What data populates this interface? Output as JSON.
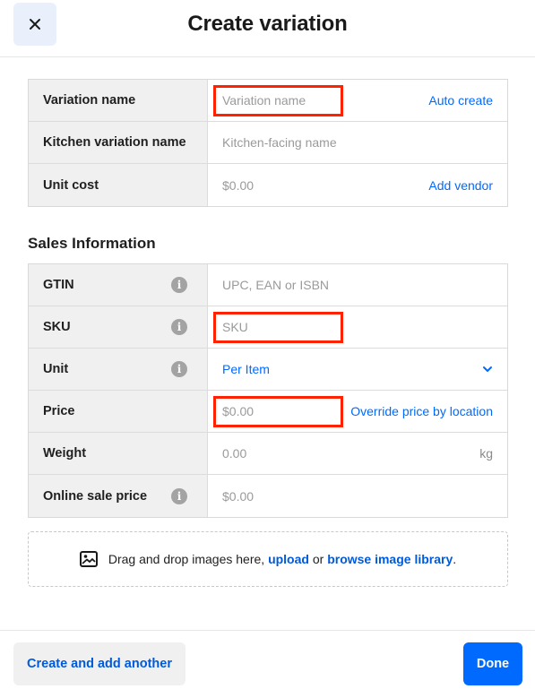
{
  "header": {
    "title": "Create variation",
    "close_icon": "close-icon"
  },
  "variation_table": {
    "rows": [
      {
        "label": "Variation name",
        "placeholder": "Variation name",
        "action": "Auto create"
      },
      {
        "label": "Kitchen variation name",
        "placeholder": "Kitchen-facing name"
      },
      {
        "label": "Unit cost",
        "placeholder": "$0.00",
        "action": "Add vendor"
      }
    ]
  },
  "sales": {
    "title": "Sales Information",
    "rows": [
      {
        "label": "GTIN",
        "placeholder": "UPC, EAN or ISBN"
      },
      {
        "label": "SKU",
        "placeholder": "SKU"
      },
      {
        "label": "Unit",
        "value": "Per Item"
      },
      {
        "label": "Price",
        "placeholder": "$0.00",
        "action": "Override price by location"
      },
      {
        "label": "Weight",
        "placeholder": "0.00",
        "suffix": "kg"
      },
      {
        "label": "Online sale price",
        "placeholder": "$0.00"
      }
    ]
  },
  "dropzone": {
    "text_before": "Drag and drop images here,",
    "upload_link": "upload",
    "or_text": "or",
    "browse_link": "browse image library",
    "period": "."
  },
  "footer": {
    "secondary_label": "Create and add another",
    "primary_label": "Done"
  },
  "colors": {
    "accent": "#006aff",
    "highlight": "#ff2200",
    "label_bg": "#f0f0f0"
  }
}
